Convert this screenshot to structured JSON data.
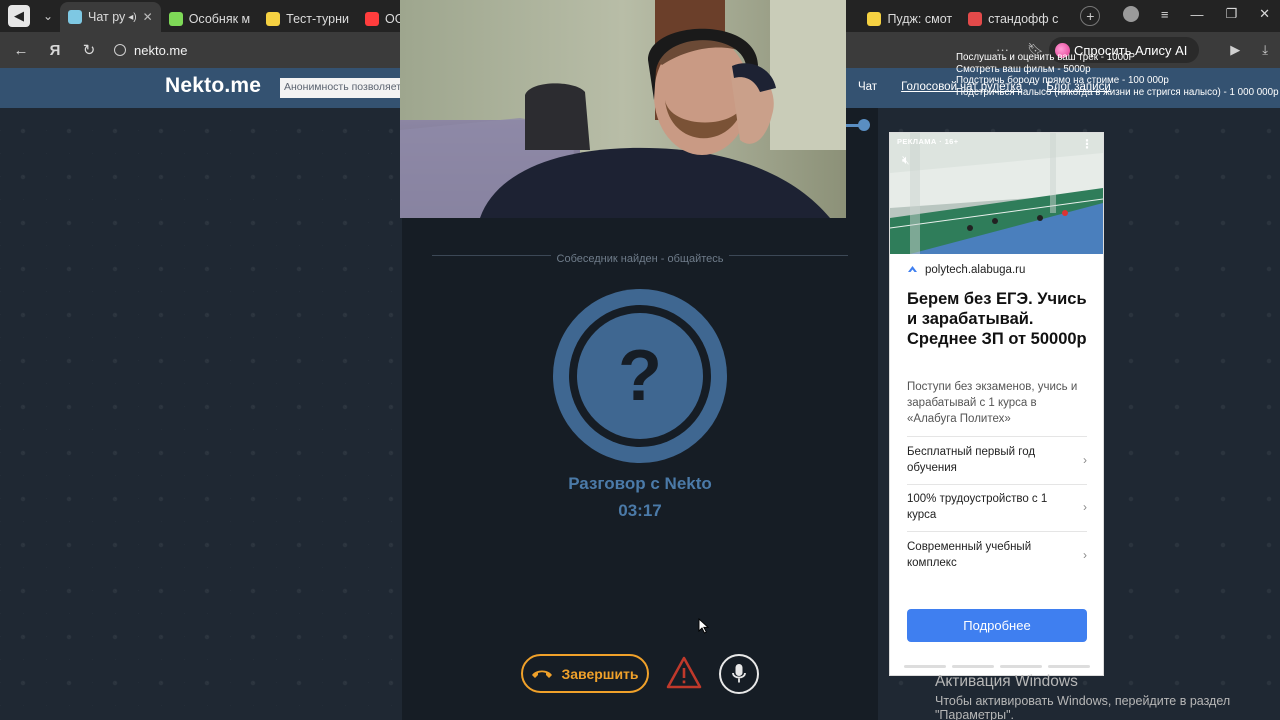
{
  "browser": {
    "tabs": [
      {
        "label": "Чат ру",
        "active": true,
        "has_audio": true,
        "favicon_color": "#7ec8e3"
      },
      {
        "label": "Особняк м",
        "active": false,
        "favicon_color": "#7ed957"
      },
      {
        "label": "Тест-турни",
        "active": false,
        "favicon_color": "#f5d142"
      },
      {
        "label": "OG",
        "active": false,
        "favicon_color": "#ff3d3d"
      },
      {
        "label": "Пудж: смот",
        "active": false,
        "favicon_color": "#f5d142"
      },
      {
        "label": "стандофф с",
        "active": false,
        "favicon_color": "#e34a4a"
      }
    ],
    "url": "nekto.me",
    "alice_label": "Спросить Алису AI"
  },
  "site": {
    "logo": "Nekto.me",
    "tagline": "Анонимность позволяет ра",
    "nav": [
      "Чат",
      "Голосовой чат рулетка",
      "Блог записи"
    ]
  },
  "stream_overlay": {
    "lines": [
      "Послушать и оценить ваш трек - 1000Р",
      "Смотреть ваш фильм - 5000р",
      "Подстричь бороду прямо на стриме - 100 000р",
      "Подстричься налысо (никогда в жизни не стригся налысо) - 1 000 000р"
    ]
  },
  "call": {
    "status": "Собеседник найден - общайтесь",
    "title": "Разговор с Nekto",
    "timer": "03:17",
    "end_label": "Завершить",
    "accent": "#f0a12a",
    "avatar_color": "#3f6791"
  },
  "ad": {
    "label": "РЕКЛАМА · 16+",
    "site": "polytech.alabuga.ru",
    "headline": "Берем без ЕГЭ. Учись и зарабатывай. Среднее ЗП от 50000р",
    "description": "Поступи без экзаменов, учись и зарабатывай с 1 курса в «Алабуга Политех»",
    "items": [
      "Бесплатный первый год обучения",
      "100% трудоустройство с 1 курса",
      "Современный учебный комплекс"
    ],
    "cta": "Подробнее",
    "cta_color": "#3f7ff0"
  },
  "windows_activation": {
    "title": "Активация Windows",
    "line1": "Чтобы активировать Windows, перейдите в раздел",
    "line2": "\"Параметры\"."
  }
}
